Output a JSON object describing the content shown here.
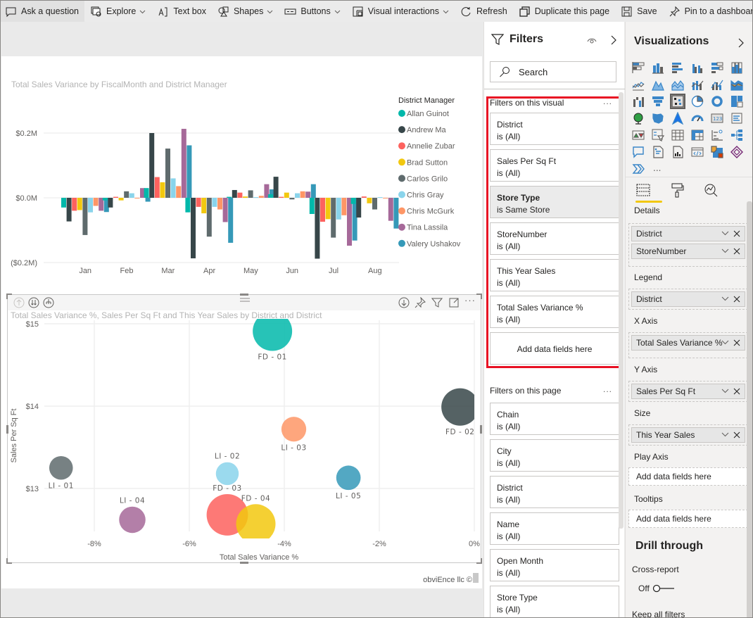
{
  "toolbar": {
    "items": [
      {
        "label": "Ask a question",
        "icon": "chat-bubble-icon"
      },
      {
        "label": "Explore",
        "icon": "explore-icon",
        "dropdown": true
      },
      {
        "label": "Text box",
        "icon": "text-box-icon"
      },
      {
        "label": "Shapes",
        "icon": "shapes-icon",
        "dropdown": true
      },
      {
        "label": "Buttons",
        "icon": "buttons-icon",
        "dropdown": true
      },
      {
        "label": "Visual interactions",
        "icon": "visual-interactions-icon",
        "dropdown": true
      },
      {
        "label": "Refresh",
        "icon": "refresh-icon"
      },
      {
        "label": "Duplicate this page",
        "icon": "duplicate-icon"
      },
      {
        "label": "Save",
        "icon": "save-icon"
      },
      {
        "label": "Pin to a dashboard",
        "icon": "pin-icon"
      }
    ]
  },
  "bar_chart": {
    "title": "Total Sales Variance by FiscalMonth and District Manager"
  },
  "scatter_chart": {
    "title": "Total Sales Variance %, Sales Per Sq Ft and This Year Sales by District and District",
    "watermark": "obviEnce llc ©"
  },
  "chart_data": [
    {
      "type": "bar",
      "title": "Total Sales Variance by FiscalMonth and District Manager",
      "xlabel": "",
      "ylabel": "",
      "categories": [
        "Jan",
        "Feb",
        "Mar",
        "Apr",
        "May",
        "Jun",
        "Jul",
        "Aug"
      ],
      "yticks": [
        "($0.2M)",
        "$0.0M",
        "$0.2M"
      ],
      "ylim": [
        -0.2,
        0.2
      ],
      "unit": "$M",
      "legend_title": "District Manager",
      "legend_position": "right",
      "series": [
        {
          "name": "Allan Guinot",
          "color": "#01B8AA",
          "values": [
            -0.03,
            -0.008,
            0.03,
            -0.045,
            0.003,
            0.011,
            -0.05,
            -0.019
          ]
        },
        {
          "name": "Andrew Ma",
          "color": "#374649",
          "values": [
            -0.073,
            -0.03,
            0.2,
            -0.187,
            0.024,
            0.065,
            -0.188,
            -0.061
          ]
        },
        {
          "name": "Annelie Zubar",
          "color": "#FD625E",
          "values": [
            -0.04,
            0.003,
            0.064,
            -0.028,
            0.016,
            0.003,
            -0.074,
            0.004
          ]
        },
        {
          "name": "Brad Sutton",
          "color": "#F2C80F",
          "values": [
            -0.038,
            -0.008,
            0.048,
            -0.048,
            0.004,
            0.016,
            -0.066,
            -0.017
          ]
        },
        {
          "name": "Carlos Grilo",
          "color": "#5F6B6D",
          "values": [
            -0.115,
            0.02,
            0.152,
            -0.12,
            0.023,
            -0.005,
            -0.123,
            -0.036
          ]
        },
        {
          "name": "Chris Gray",
          "color": "#8AD4EB",
          "values": [
            -0.045,
            0.014,
            0.06,
            -0.028,
            0.002,
            0.014,
            -0.067,
            0.002
          ]
        },
        {
          "name": "Chris McGurk",
          "color": "#FE9666",
          "values": [
            -0.025,
            -0.002,
            0.036,
            -0.036,
            0.006,
            0.02,
            -0.054,
            -0.002
          ]
        },
        {
          "name": "Tina Lassila",
          "color": "#A66999",
          "values": [
            -0.04,
            0.03,
            0.213,
            -0.075,
            0.042,
            0.019,
            -0.148,
            -0.071
          ]
        },
        {
          "name": "Valery Ushakov",
          "color": "#3599B8",
          "values": [
            -0.044,
            -0.012,
            0.162,
            -0.139,
            0.026,
            0.042,
            -0.132,
            -0.095
          ]
        }
      ]
    },
    {
      "type": "scatter",
      "title": "Total Sales Variance %, Sales Per Sq Ft and This Year Sales by District and District",
      "xlabel": "Total Sales Variance %",
      "ylabel": "Sales Per Sq Ft",
      "xticks": [
        "-8%",
        "-6%",
        "-4%",
        "-2%",
        "0%"
      ],
      "yticks": [
        "$13",
        "$14",
        "$15"
      ],
      "xlim": [
        -9.3,
        0
      ],
      "ylim": [
        12.5,
        15.0
      ],
      "grid": true,
      "size_field": "This Year Sales",
      "points": [
        {
          "label": "FD - 01",
          "x": -4.25,
          "y": 14.91,
          "size": 1.0,
          "color": "#01B8AA"
        },
        {
          "label": "FD - 02",
          "x": -0.3,
          "y": 13.99,
          "size": 0.95,
          "color": "#374649"
        },
        {
          "label": "FD - 03",
          "x": -5.2,
          "y": 12.68,
          "size": 1.05,
          "color": "#FD625E"
        },
        {
          "label": "FD - 04",
          "x": -4.6,
          "y": 12.57,
          "size": 1.0,
          "color": "#F2C80F"
        },
        {
          "label": "LI - 01",
          "x": -8.7,
          "y": 13.25,
          "size": 0.6,
          "color": "#5F6B6D"
        },
        {
          "label": "LI - 02",
          "x": -5.2,
          "y": 13.18,
          "size": 0.58,
          "color": "#8AD4EB"
        },
        {
          "label": "LI - 03",
          "x": -3.8,
          "y": 13.72,
          "size": 0.63,
          "color": "#FE9666"
        },
        {
          "label": "LI - 04",
          "x": -7.2,
          "y": 12.62,
          "size": 0.67,
          "color": "#A66999"
        },
        {
          "label": "LI - 05",
          "x": -2.65,
          "y": 13.13,
          "size": 0.62,
          "color": "#3599B8"
        }
      ]
    }
  ],
  "filters": {
    "title": "Filters",
    "search_placeholder": "Search",
    "visual_section": "Filters on this visual",
    "visual_filters": [
      {
        "name": "District",
        "state": "is (All)"
      },
      {
        "name": "Sales Per Sq Ft",
        "state": "is (All)"
      },
      {
        "name": "Store Type",
        "state": "is Same Store",
        "active": true
      },
      {
        "name": "StoreNumber",
        "state": "is (All)"
      },
      {
        "name": "This Year Sales",
        "state": "is (All)"
      },
      {
        "name": "Total Sales Variance %",
        "state": "is (All)"
      }
    ],
    "add_fields": "Add data fields here",
    "page_section": "Filters on this page",
    "page_filters": [
      {
        "name": "Chain",
        "state": "is (All)"
      },
      {
        "name": "City",
        "state": "is (All)"
      },
      {
        "name": "District",
        "state": "is (All)"
      },
      {
        "name": "Name",
        "state": "is (All)"
      },
      {
        "name": "Open Month",
        "state": "is (All)"
      },
      {
        "name": "Store Type",
        "state": "is (All)"
      }
    ],
    "more": "..."
  },
  "visualizations": {
    "title": "Visualizations",
    "more_visuals": "...",
    "wells": [
      {
        "label": "Details",
        "fields": [
          "District",
          "StoreNumber"
        ]
      },
      {
        "label": "Legend",
        "fields": [
          "District"
        ]
      },
      {
        "label": "X Axis",
        "fields": [
          "Total Sales Variance %"
        ]
      },
      {
        "label": "Y Axis",
        "fields": [
          "Sales Per Sq Ft"
        ]
      },
      {
        "label": "Size",
        "fields": [
          "This Year Sales"
        ]
      },
      {
        "label": "Play Axis",
        "placeholder": "Add data fields here"
      },
      {
        "label": "Tooltips",
        "placeholder": "Add data fields here"
      }
    ],
    "drill_through": "Drill through",
    "cross_report": "Cross-report",
    "toggle_state": "Off",
    "keep_filters": "Keep all filters"
  }
}
